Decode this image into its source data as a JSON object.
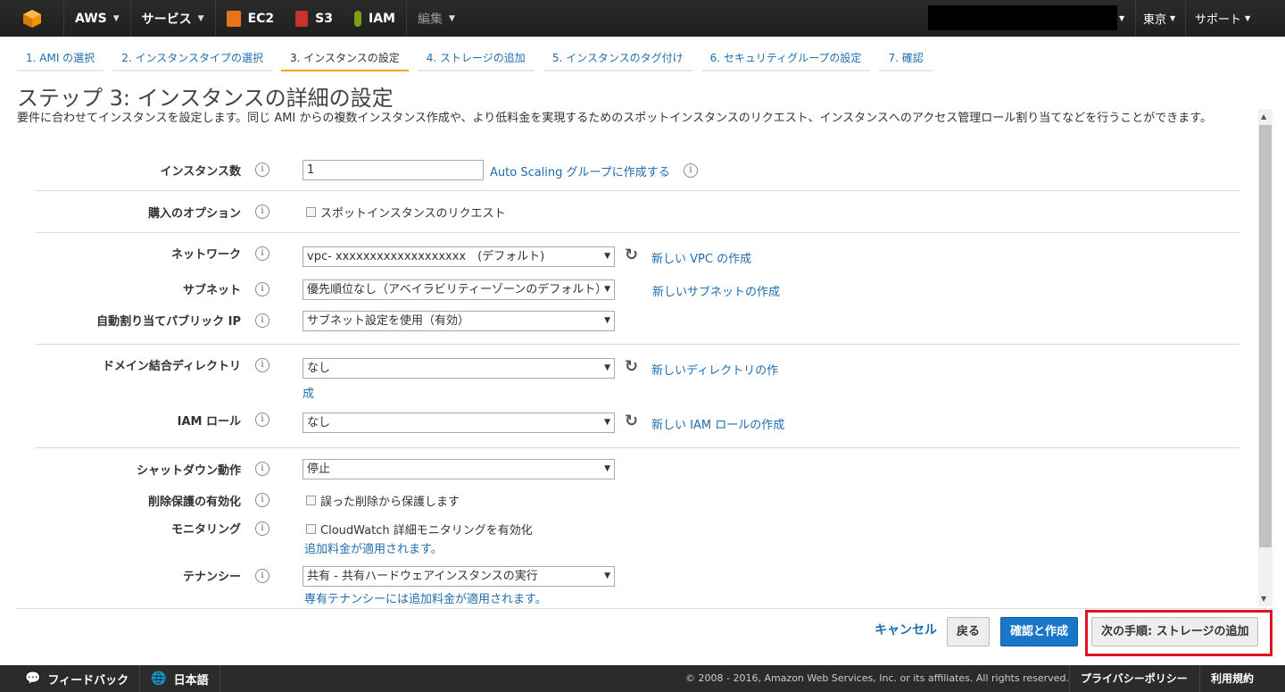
{
  "topnav": {
    "aws_label": "AWS",
    "services_label": "サービス",
    "ec2_label": "EC2",
    "s3_label": "S3",
    "iam_label": "IAM",
    "edit_label": "編集",
    "region_label": "東京",
    "support_label": "サポート"
  },
  "wizard": {
    "tabs": [
      {
        "label": "1. AMI の選択"
      },
      {
        "label": "2. インスタンスタイプの選択"
      },
      {
        "label": "3. インスタンスの設定"
      },
      {
        "label": "4. ストレージの追加"
      },
      {
        "label": "5. インスタンスのタグ付け"
      },
      {
        "label": "6. セキュリティグループの設定"
      },
      {
        "label": "7. 確認"
      }
    ],
    "active_tab": 2
  },
  "page": {
    "title": "ステップ 3: インスタンスの詳細の設定",
    "description": "要件に合わせてインスタンスを設定します。同じ AMI からの複数インスタンス作成や、より低料金を実現するためのスポットインスタンスのリクエスト、インスタンスへのアクセス管理ロール割り当てなどを行うことができます。"
  },
  "form": {
    "instance_count": {
      "label": "インスタンス数",
      "value": "1",
      "link": "Auto Scaling グループに作成する"
    },
    "purchase_option": {
      "label": "購入のオプション",
      "checkbox": "スポットインスタンスのリクエスト"
    },
    "network": {
      "label": "ネットワーク",
      "value": "vpc- xxxxxxxxxxxxxxxxxxx　(デフォルト)",
      "link": "新しい VPC の作成"
    },
    "subnet": {
      "label": "サブネット",
      "value": "優先順位なし（アベイラビリティーゾーンのデフォルト）",
      "link": "新しいサブネットの作成"
    },
    "public_ip": {
      "label": "自動割り当てパブリック IP",
      "value": "サブネット設定を使用（有効）"
    },
    "domain_dir": {
      "label": "ドメイン結合ディレクトリ",
      "value": "なし",
      "link_line1": "新しいディレクトリの作",
      "link_line2": "成"
    },
    "iam_role": {
      "label": "IAM ロール",
      "value": "なし",
      "link": "新しい IAM ロールの作成"
    },
    "shutdown": {
      "label": "シャットダウン動作",
      "value": "停止"
    },
    "termination": {
      "label": "削除保護の有効化",
      "checkbox": "誤った削除から保護します"
    },
    "monitoring": {
      "label": "モニタリング",
      "checkbox": "CloudWatch 詳細モニタリングを有効化",
      "note": "追加料金が適用されます。"
    },
    "tenancy": {
      "label": "テナンシー",
      "value": "共有 - 共有ハードウェアインスタンスの実行",
      "note": "専有テナンシーには追加料金が適用されます。"
    }
  },
  "actions": {
    "cancel": "キャンセル",
    "back": "戻る",
    "review_launch": "確認と作成",
    "next": "次の手順: ストレージの追加"
  },
  "footer": {
    "feedback": "フィードバック",
    "language": "日本語",
    "copyright": "© 2008 - 2016, Amazon Web Services, Inc. or its affiliates. All rights reserved.",
    "privacy": "プライバシーポリシー",
    "terms": "利用規約"
  },
  "info_glyph": "i",
  "colors": {
    "accent_link": "#1f6dad",
    "primary_button": "#1a76c9",
    "active_tab": "#f0a30a",
    "highlight": "#e0141e"
  }
}
